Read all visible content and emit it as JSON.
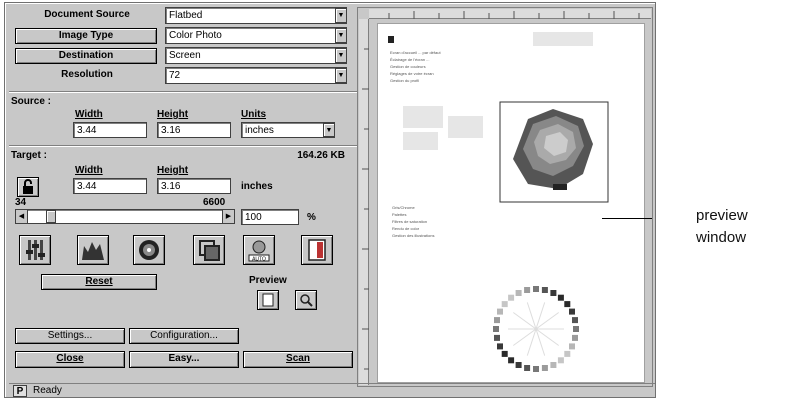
{
  "controls": {
    "document_source": {
      "label": "Document Source",
      "value": "Flatbed"
    },
    "image_type": {
      "label": "Image Type",
      "value": "Color Photo"
    },
    "destination": {
      "label": "Destination",
      "value": "Screen"
    },
    "resolution": {
      "label": "Resolution",
      "value": "72"
    }
  },
  "source": {
    "title": "Source :",
    "width_label": "Width",
    "height_label": "Height",
    "units_label": "Units",
    "width": "3.44",
    "height": "3.16",
    "units": "inches"
  },
  "target": {
    "title": "Target :",
    "size": "164.26 KB",
    "width_label": "Width",
    "height_label": "Height",
    "width": "3.44",
    "height": "3.16",
    "units": "inches",
    "scale_min": "34",
    "scale_max": "6600",
    "scale_value": "100",
    "scale_unit": "%"
  },
  "preview": {
    "label": "Preview"
  },
  "buttons": {
    "reset": "Reset",
    "settings": "Settings...",
    "configuration": "Configuration...",
    "close": "Close",
    "easy": "Easy...",
    "scan": "Scan"
  },
  "status": {
    "badge": "P",
    "text": "Ready"
  },
  "preview_page": {
    "lines_top": [
      "Ecran d'accueil ... par défaut",
      "Éclairage de l'écran ...",
      "Gestion de couleurs",
      "Réglages de votre écran",
      "Gestion du profil"
    ],
    "lines_mid": [
      "Gris/Chrome",
      "Palettes",
      "Filtres de saturation",
      "Rendu de color",
      "Gestion des illustrations"
    ]
  },
  "callout": {
    "line1": "preview",
    "line2": "window"
  },
  "icons": [
    "tone-icon",
    "histogram-icon",
    "color-icon",
    "adjust-icon",
    "auto-exposure-icon",
    "destination-icon",
    "page-preview-icon",
    "zoom-preview-icon"
  ]
}
